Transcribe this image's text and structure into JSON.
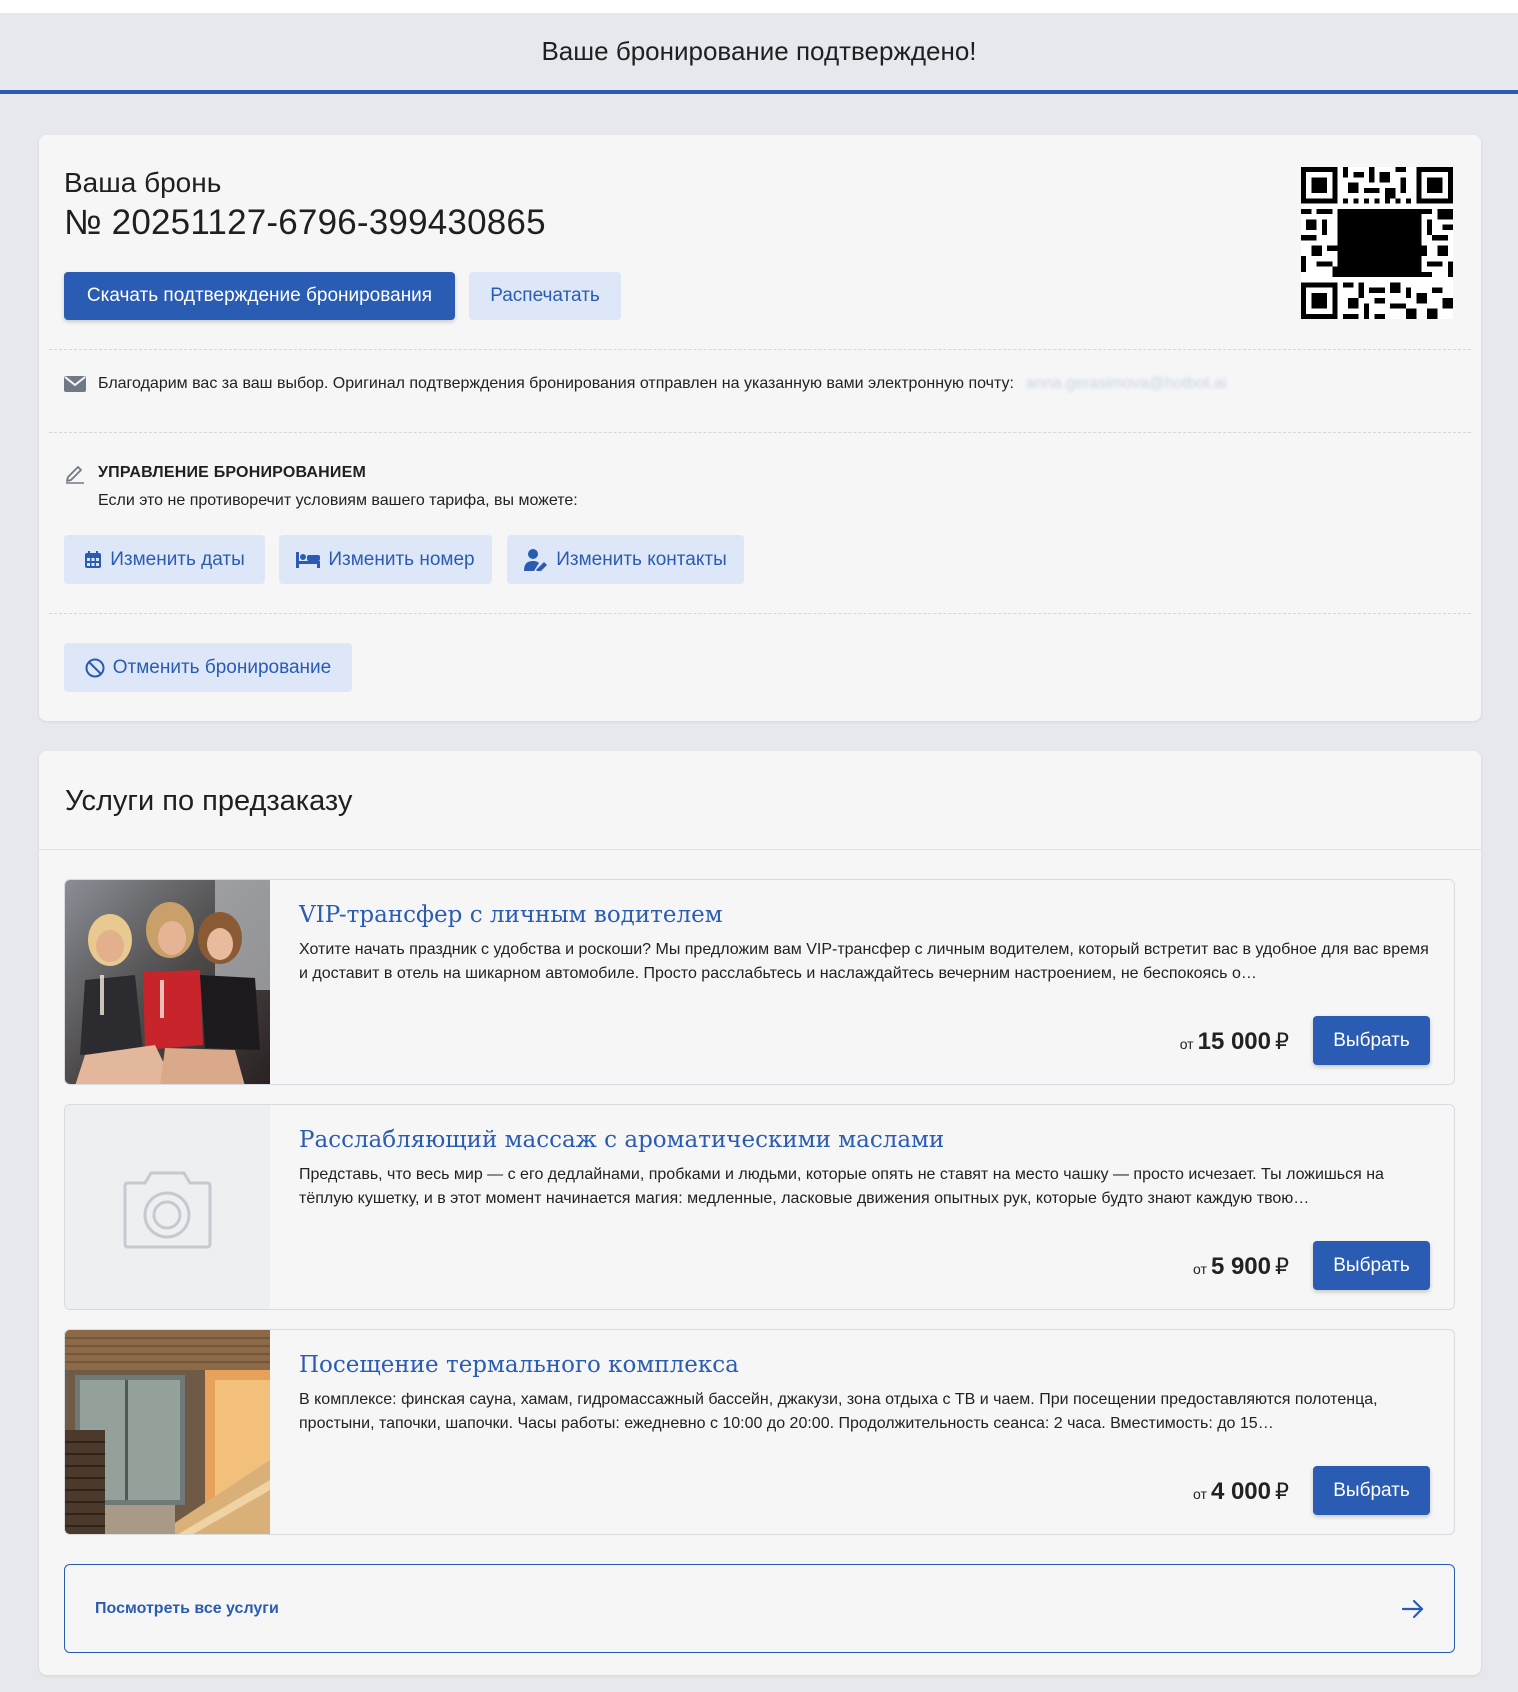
{
  "header": {
    "title": "Ваше бронирование подтверждено!"
  },
  "booking": {
    "label": "Ваша бронь",
    "number": "№ 20251127-6796-399430865",
    "download_label": "Скачать подтверждение бронирования",
    "print_label": "Распечатать",
    "email_text": "Благодарим вас за ваш выбор. Оригинал подтверждения бронирования отправлен на указанную вами электронную почту:",
    "email_value": "anna.gerasimova@hotbot.ai",
    "manage_title": "УПРАВЛЕНИЕ БРОНИРОВАНИЕМ",
    "manage_subtitle": "Если это не противоречит условиям вашего тарифа, вы можете:",
    "change_dates": "Изменить даты",
    "change_room": "Изменить номер",
    "change_contacts": "Изменить контакты",
    "cancel": "Отменить бронирование"
  },
  "services": {
    "title": "Услуги по предзаказу",
    "items": [
      {
        "title": "VIP-трансфер с личным водителем",
        "description": "Хотите начать праздник с удобства и роскоши? Мы предложим вам VIP-трансфер с личным водителем, который встретит вас в удобное для вас время и доставит в отель на шикарном автомобиле. Просто расслабьтесь и наслаждайтесь вечерним настроением, не беспокоясь о…",
        "price_from": "от",
        "price": "15 000",
        "currency": "₽",
        "button": "Выбрать",
        "image": "photo-limousine"
      },
      {
        "title": "Расслабляющий массаж с ароматическими маслами",
        "description": "Представь, что весь мир — с его дедлайнами, пробками и людьми, которые опять не ставят на место чашку — просто исчезает. Ты ложишься на тёплую кушетку, и в этот момент начинается магия: медленные, ласковые движения опытных рук, которые будто знают каждую твою…",
        "price_from": "от",
        "price": "5 900",
        "currency": "₽",
        "button": "Выбрать",
        "image": "camera-placeholder-icon"
      },
      {
        "title": "Посещение термального комплекса",
        "description": "В комплексе: финская сауна, хамам, гидромассажный бассейн, джакузи, зона отдыха с ТВ и чаем. При посещении предоставляются полотенца, простыни, тапочки, шапочки. Часы работы: ежедневно с 10:00 до 20:00. Продолжительность сеанса: 2 часа. Вместимость: до 15…",
        "price_from": "от",
        "price": "4 000",
        "currency": "₽",
        "button": "Выбрать",
        "image": "photo-sauna"
      }
    ],
    "view_all": "Посмотреть все услуги"
  },
  "colors": {
    "accent": "#2a5cb4",
    "soft_button": "#dde7f7",
    "background": "#e6e8ed",
    "card": "#f6f6f7"
  }
}
